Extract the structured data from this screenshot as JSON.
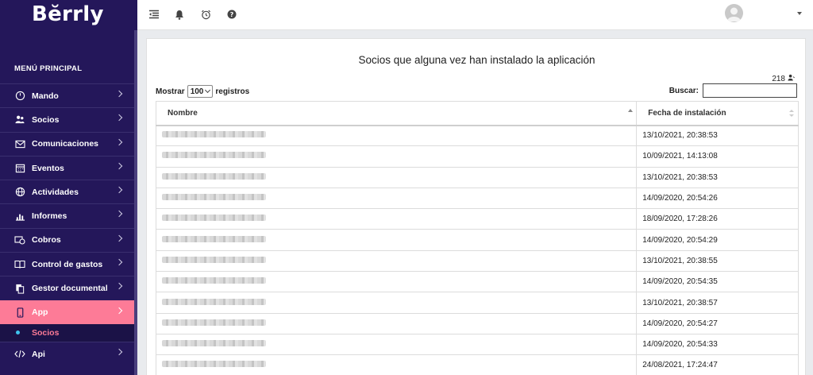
{
  "app": {
    "brand": "Bĕrrly"
  },
  "sidebar": {
    "heading": "MENÚ PRINCIPAL",
    "items": [
      {
        "label": "Mando",
        "icon": "dashboard-icon"
      },
      {
        "label": "Socios",
        "icon": "users-icon"
      },
      {
        "label": "Comunicaciones",
        "icon": "mail-icon"
      },
      {
        "label": "Eventos",
        "icon": "calendar-icon"
      },
      {
        "label": "Actividades",
        "icon": "globe-icon"
      },
      {
        "label": "Informes",
        "icon": "chart-icon"
      },
      {
        "label": "Cobros",
        "icon": "money-icon"
      },
      {
        "label": "Control de gastos",
        "icon": "book-icon"
      },
      {
        "label": "Gestor documental",
        "icon": "documents-icon"
      },
      {
        "label": "App",
        "icon": "mobile-icon",
        "active": true
      },
      {
        "label": "Api",
        "icon": "code-icon"
      }
    ],
    "submenu": {
      "label": "Socios"
    }
  },
  "topbar": {
    "icons": [
      "menu-collapse-icon",
      "bell-icon",
      "alarm-icon",
      "help-icon"
    ]
  },
  "main": {
    "title": "Socios que alguna vez han instalado la aplicación",
    "count": "218",
    "length_prefix": "Mostrar",
    "length_value": "100",
    "length_suffix": "registros",
    "search_label": "Buscar:",
    "search_value": "",
    "table": {
      "columns": [
        "Nombre",
        "Fecha de instalación"
      ],
      "rows": [
        {
          "date": "13/10/2021, 20:38:53"
        },
        {
          "date": "10/09/2021, 14:13:08"
        },
        {
          "date": "13/10/2021, 20:38:53"
        },
        {
          "date": "14/09/2020, 20:54:26"
        },
        {
          "date": "18/09/2020, 17:28:26"
        },
        {
          "date": "14/09/2020, 20:54:29"
        },
        {
          "date": "13/10/2021, 20:38:55"
        },
        {
          "date": "14/09/2020, 20:54:35"
        },
        {
          "date": "13/10/2021, 20:38:57"
        },
        {
          "date": "14/09/2020, 20:54:27"
        },
        {
          "date": "14/09/2020, 20:54:33"
        },
        {
          "date": "24/08/2021, 17:24:47"
        }
      ]
    }
  },
  "colors": {
    "sidebar_bg": "#24175a",
    "active_item": "#fd7b97",
    "submenu_dot": "#3fc3ee"
  }
}
